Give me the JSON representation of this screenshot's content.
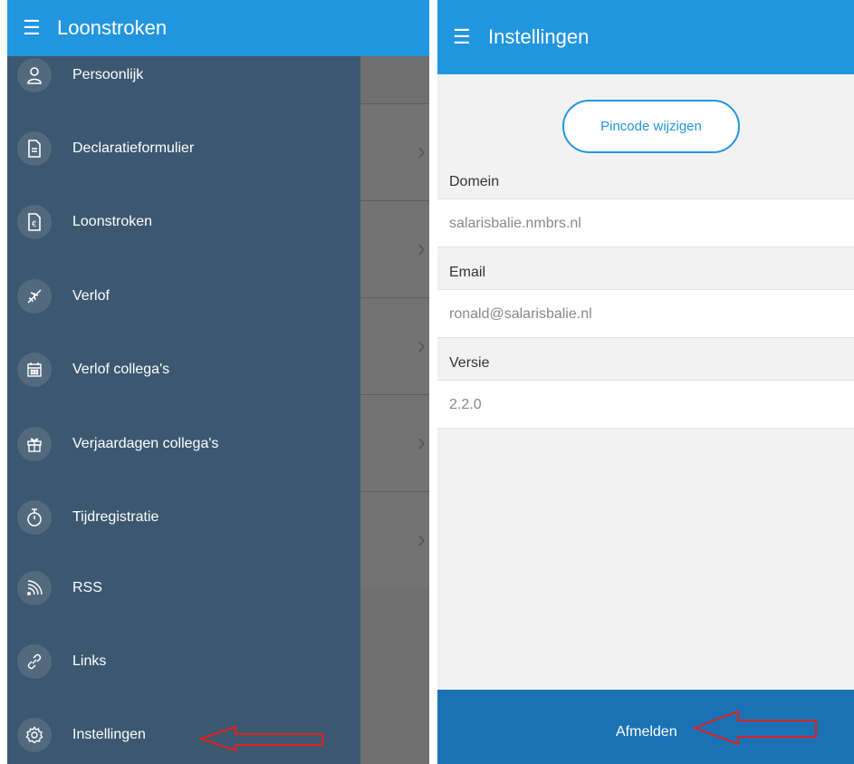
{
  "left": {
    "title": "Loonstroken",
    "menu": [
      {
        "label": "Persoonlijk",
        "icon": "person-icon"
      },
      {
        "label": "Declaratieformulier",
        "icon": "document-icon"
      },
      {
        "label": "Loonstroken",
        "icon": "euro-document-icon"
      },
      {
        "label": "Verlof",
        "icon": "airplane-icon"
      },
      {
        "label": "Verlof collega's",
        "icon": "calendar-icon"
      },
      {
        "label": "Verjaardagen collega's",
        "icon": "gift-icon"
      },
      {
        "label": "Tijdregistratie",
        "icon": "stopwatch-icon"
      },
      {
        "label": "RSS",
        "icon": "rss-icon"
      },
      {
        "label": "Links",
        "icon": "link-icon"
      },
      {
        "label": "Instellingen",
        "icon": "gear-icon"
      }
    ]
  },
  "right": {
    "title": "Instellingen",
    "pin_button": "Pincode wijzigen",
    "domain_label": "Domein",
    "domain_value": "salarisbalie.nmbrs.nl",
    "email_label": "Email",
    "email_value": "ronald@salarisbalie.nl",
    "version_label": "Versie",
    "version_value": "2.2.0",
    "logout": "Afmelden"
  },
  "colors": {
    "appbar": "#2196de",
    "drawer": "#3c5870",
    "logout_bar": "#1a72b4",
    "annotation_arrow": "#e02020"
  }
}
